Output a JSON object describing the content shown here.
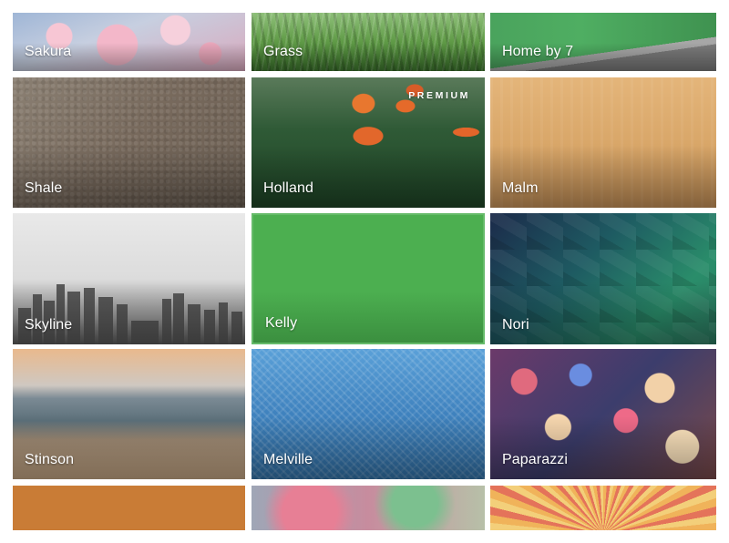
{
  "tiles": [
    {
      "id": "sakura",
      "label": "Sakura"
    },
    {
      "id": "grass",
      "label": "Grass"
    },
    {
      "id": "home-by-7",
      "label": "Home by 7"
    },
    {
      "id": "shale",
      "label": "Shale"
    },
    {
      "id": "holland",
      "label": "Holland",
      "badge": "PREMIUM"
    },
    {
      "id": "malm",
      "label": "Malm"
    },
    {
      "id": "skyline",
      "label": "Skyline"
    },
    {
      "id": "kelly",
      "label": "Kelly",
      "selected": true
    },
    {
      "id": "nori",
      "label": "Nori"
    },
    {
      "id": "stinson",
      "label": "Stinson"
    },
    {
      "id": "melville",
      "label": "Melville"
    },
    {
      "id": "paparazzi",
      "label": "Paparazzi"
    }
  ],
  "colors": {
    "selected_border": "#66bb6a",
    "kelly_green": "#4caf50"
  }
}
